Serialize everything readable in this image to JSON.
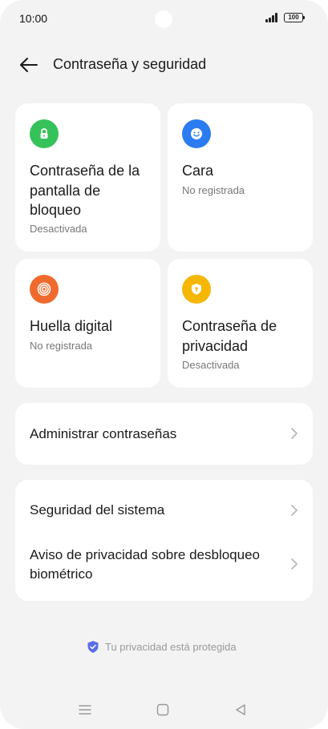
{
  "status_bar": {
    "time": "10:00",
    "battery": "100"
  },
  "header": {
    "title": "Contraseña y seguridad"
  },
  "tiles": [
    {
      "title": "Contraseña de la pantalla de bloqueo",
      "subtitle": "Desactivada",
      "icon": "lock-icon",
      "color": "#36c25a"
    },
    {
      "title": "Cara",
      "subtitle": "No registrada",
      "icon": "face-icon",
      "color": "#2a7cf0"
    },
    {
      "title": "Huella digital",
      "subtitle": "No registrada",
      "icon": "fingerprint-icon",
      "color": "#f06a2e"
    },
    {
      "title": "Contraseña de privacidad",
      "subtitle": "Desactivada",
      "icon": "privacy-shield-icon",
      "color": "#f5b700"
    }
  ],
  "rows": {
    "manage_passwords": "Administrar contraseñas",
    "system_security": "Seguridad del sistema",
    "biometric_notice": "Aviso de privacidad sobre desbloqueo biométrico"
  },
  "footer": {
    "text": "Tu privacidad está protegida"
  }
}
